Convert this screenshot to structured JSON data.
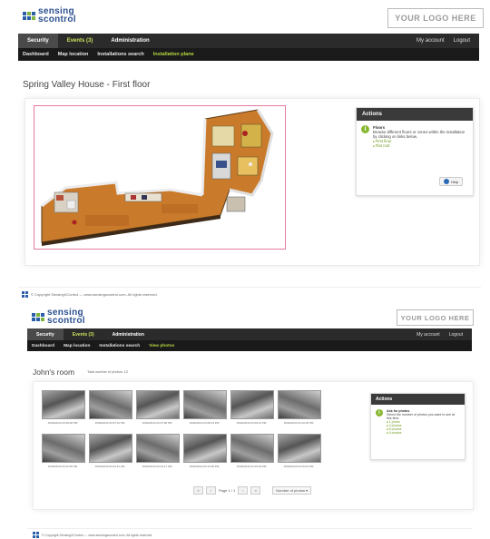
{
  "screen1": {
    "logo": {
      "text1": "sensing",
      "text2": "scontrol"
    },
    "your_logo": "YOUR LOGO HERE",
    "nav": {
      "security": "Security",
      "events": "Events (3)",
      "administration": "Administration",
      "my_account": "My account",
      "logout": "Logout"
    },
    "subnav": {
      "dashboard": "Dashboard",
      "map_location": "Map location",
      "installations_search": "Installations search",
      "installation_plane": "Installation plane"
    },
    "title": "Spring Valley House - First floor",
    "actions": {
      "header": "Actions",
      "heading": "Floors",
      "description": "Browse different floors or zones within the installation by clicking on links below.",
      "links": [
        "First floor",
        "Flat roof"
      ],
      "help_button": "Help"
    },
    "footer": "© Copyright SensingXControl — www.sensingscontrol.com. All rights reserved."
  },
  "screen2": {
    "logo": {
      "text1": "sensing",
      "text2": "scontrol"
    },
    "your_logo": "YOUR LOGO HERE",
    "nav": {
      "security": "Security",
      "events": "Events (3)",
      "administration": "Administration",
      "my_account": "My account",
      "logout": "Logout"
    },
    "subnav": {
      "dashboard": "Dashboard",
      "map_location": "Map location",
      "installations_search": "Installations search",
      "view_photos": "View photos"
    },
    "title": "John's room",
    "total_photos": "Total number of photos: 12",
    "photos": [
      {
        "ts": "15/02/2013 03:06:48 PM"
      },
      {
        "ts": "15/02/2013 03:07:12 PM"
      },
      {
        "ts": "15/02/2013 03:07:48 PM"
      },
      {
        "ts": "15/02/2013 03:08:14 PM"
      },
      {
        "ts": "15/02/2013 03:09:21 PM"
      },
      {
        "ts": "15/02/2013 03:10:02 PM"
      },
      {
        "ts": "15/02/2013 03:11:05 PM"
      },
      {
        "ts": "15/02/2013 03:12:41 PM"
      },
      {
        "ts": "15/02/2013 03:13:17 PM"
      },
      {
        "ts": "15/02/2013 03:14:30 PM"
      },
      {
        "ts": "15/02/2013 03:15:02 PM"
      },
      {
        "ts": "15/02/2013 03:16:44 PM"
      }
    ],
    "pager": {
      "page": "Page 1 / 1",
      "number_of_photos": "Number of photos"
    },
    "actions": {
      "header": "Actions",
      "heading": "Ask for photos",
      "description": "Select the number of photos you want to see at this time.",
      "links": [
        "1 photo",
        "3 photos",
        "5 photos",
        "9 photos"
      ]
    },
    "footer": "© Copyright SensingXControl — www.sensingscontrol.com. All rights reserved."
  }
}
